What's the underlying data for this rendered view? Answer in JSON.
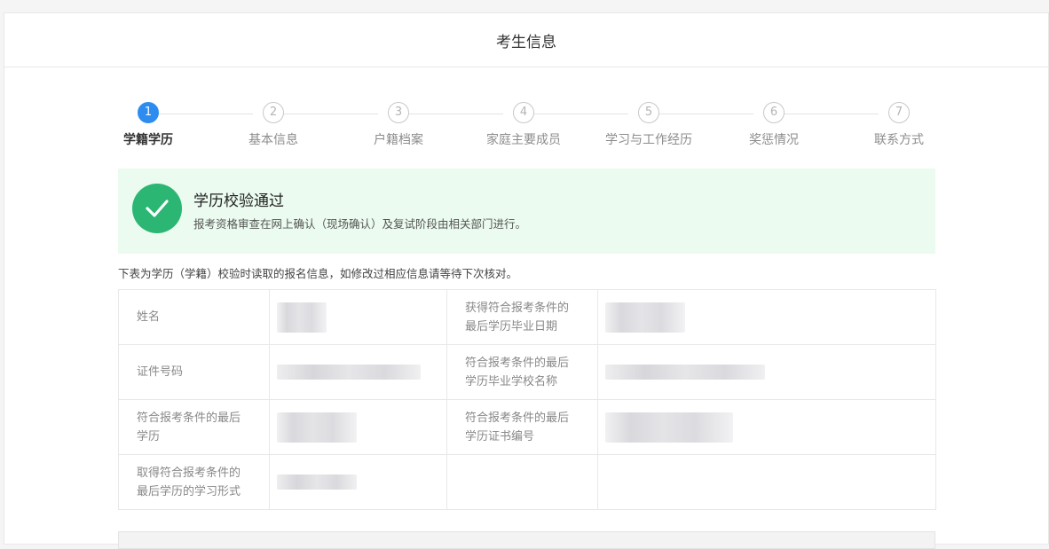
{
  "header": {
    "title": "考生信息"
  },
  "steps": [
    {
      "num": "1",
      "label": "学籍学历",
      "active": true
    },
    {
      "num": "2",
      "label": "基本信息",
      "active": false
    },
    {
      "num": "3",
      "label": "户籍档案",
      "active": false
    },
    {
      "num": "4",
      "label": "家庭主要成员",
      "active": false
    },
    {
      "num": "5",
      "label": "学习与工作经历",
      "active": false
    },
    {
      "num": "6",
      "label": "奖惩情况",
      "active": false
    },
    {
      "num": "7",
      "label": "联系方式",
      "active": false
    }
  ],
  "success": {
    "title": "学历校验通过",
    "desc": "报考资格审查在网上确认（现场确认）及复试阶段由相关部门进行。",
    "color": "#2bb673"
  },
  "note": "下表为学历（学籍）校验时读取的报名信息，如修改过相应信息请等待下次核对。",
  "table": {
    "rows": [
      {
        "label1": "姓名",
        "label2": "获得符合报考条件的最后学历毕业日期"
      },
      {
        "label1": "证件号码",
        "label2": "符合报考条件的最后学历毕业学校名称"
      },
      {
        "label1": "符合报考条件的最后学历",
        "label2": "符合报考条件的最后学历证书编号"
      },
      {
        "label1": "取得符合报考条件的最后学历的学习形式",
        "label2": ""
      }
    ]
  },
  "colors": {
    "accent": "#2d8cf0",
    "success_bg": "#ebfbef"
  }
}
